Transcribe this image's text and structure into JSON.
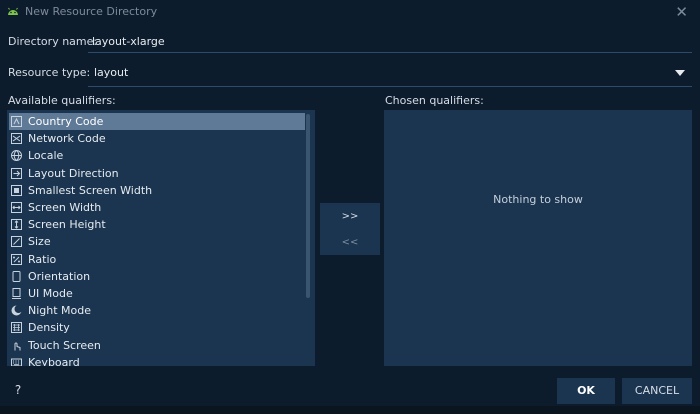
{
  "window": {
    "title": "New Resource Directory",
    "close_glyph": "✕"
  },
  "directory": {
    "label": "Directory name:",
    "value": "layout-xlarge"
  },
  "resource_type": {
    "label": "Resource type:",
    "value": "layout"
  },
  "available": {
    "label": "Available qualifiers:",
    "items": [
      {
        "label": "Country Code",
        "icon": "country-code-icon",
        "selected": true
      },
      {
        "label": "Network Code",
        "icon": "network-code-icon"
      },
      {
        "label": "Locale",
        "icon": "globe-icon"
      },
      {
        "label": "Layout Direction",
        "icon": "layout-direction-icon"
      },
      {
        "label": "Smallest Screen Width",
        "icon": "smallest-width-icon"
      },
      {
        "label": "Screen Width",
        "icon": "screen-width-icon"
      },
      {
        "label": "Screen Height",
        "icon": "screen-height-icon"
      },
      {
        "label": "Size",
        "icon": "size-icon"
      },
      {
        "label": "Ratio",
        "icon": "ratio-icon"
      },
      {
        "label": "Orientation",
        "icon": "orientation-icon"
      },
      {
        "label": "UI Mode",
        "icon": "ui-mode-icon"
      },
      {
        "label": "Night Mode",
        "icon": "night-mode-icon"
      },
      {
        "label": "Density",
        "icon": "density-icon"
      },
      {
        "label": "Touch Screen",
        "icon": "touch-screen-icon"
      },
      {
        "label": "Keyboard",
        "icon": "keyboard-icon"
      }
    ]
  },
  "move": {
    "add": ">>",
    "remove": "<<"
  },
  "chosen": {
    "label": "Chosen qualifiers:",
    "empty_message": "Nothing to show"
  },
  "footer": {
    "help": "?",
    "ok": "OK",
    "cancel": "CANCEL"
  },
  "colors": {
    "background": "#0d1c2c",
    "panel": "#1b3550",
    "selected_row": "#5f7a96",
    "android_green": "#7cc44a"
  }
}
